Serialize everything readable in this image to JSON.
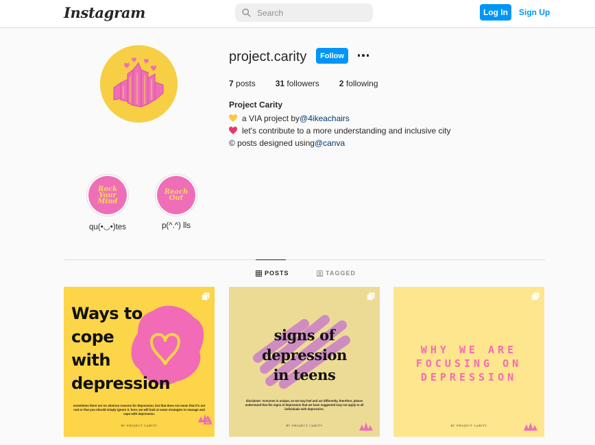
{
  "nav": {
    "logo": "Instagram",
    "search_placeholder": "Search",
    "login_label": "Log In",
    "signup_label": "Sign Up"
  },
  "profile": {
    "username": "project.carity",
    "follow_label": "Follow",
    "stats": {
      "posts": "7",
      "posts_label": "posts",
      "followers": "31",
      "followers_label": "followers",
      "following": "2",
      "following_label": "following"
    },
    "full_name": "Project Carity",
    "bio": {
      "line1_text": "a VIA project by ",
      "line1_link": "@4ikeachairs",
      "line2_text": "let's contribute to a more understanding and inclusive city",
      "line3_text": "© posts designed using ",
      "line3_link": "@canva"
    }
  },
  "highlights": [
    {
      "label": "qu(•◡•)tes",
      "cover_text": "Rock Your Mind"
    },
    {
      "label": "p(^.^) lls",
      "cover_text": "Reach Out"
    }
  ],
  "tabs": [
    {
      "label": "POSTS",
      "icon": "grid-icon",
      "active": true
    },
    {
      "label": "TAGGED",
      "icon": "tag-icon",
      "active": false
    }
  ],
  "posts": [
    {
      "title_lines": [
        "Ways to",
        "cope",
        "with",
        "depression"
      ],
      "description": "sometimes there are no obvious reasons for depression, but that does not mean that it's not real or that you should simply ignore it. here, we will look at some strategies to manage and cope with depression.",
      "credit": "BY PROJECT CARITY",
      "background": "#fcd548"
    },
    {
      "title_lines": [
        "signs of",
        "depression",
        "in teens"
      ],
      "description": "disclaimer: everyone is unique, so we may feel and act differently. therefore, please understand that the signs of depression that we have suggested may not apply to all individuals with depression.",
      "credit": "BY PROJECT CARITY",
      "background": "#ecdb95"
    },
    {
      "title_lines": [
        "WHY WE ARE",
        "FOCUSING ON",
        "DEPRESSION"
      ],
      "credit": "BY PROJECT CARITY",
      "background": "#fde68e"
    }
  ],
  "colors": {
    "accent": "#0095f6",
    "brand_pink": "#ee6fb7",
    "brand_yellow": "#f6cf45"
  }
}
